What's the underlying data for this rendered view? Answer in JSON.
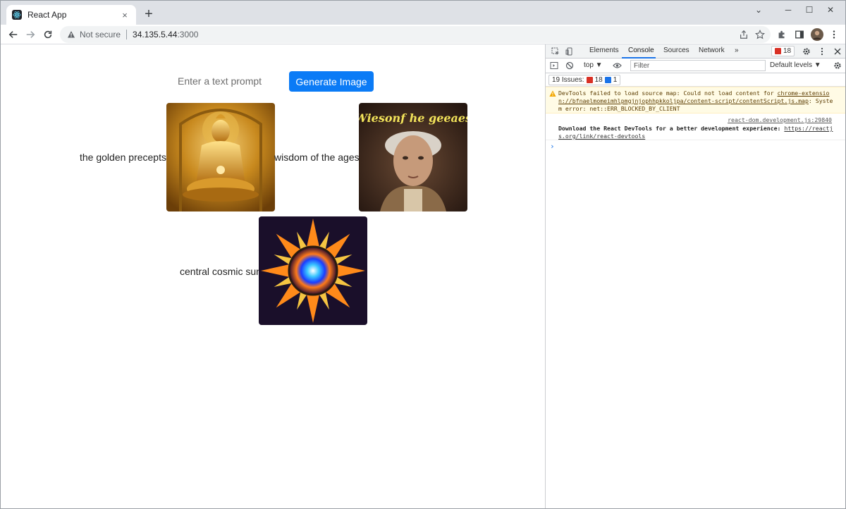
{
  "browser": {
    "tab_title": "React App",
    "tab_close": "×",
    "new_tab": "+",
    "window_controls": {
      "dropdown": "⌄",
      "minimize": "─",
      "maximize": "☐",
      "close": "✕"
    },
    "security_text": "Not secure",
    "url_host": "34.135.5.44",
    "url_port": ":3000",
    "toolbar_icons": [
      "share-icon",
      "star-icon",
      "extensions-icon",
      "sidepanel-icon",
      "profile-avatar",
      "menu-icon"
    ]
  },
  "app": {
    "prompt_placeholder": "Enter a text prompt",
    "generate_label": "Generate Image",
    "results": [
      {
        "caption": "the golden precepts",
        "image": "golden-buddha-statue"
      },
      {
        "caption": "wisdom of the ages",
        "image": "old-man-portrait",
        "image_text": "Wiesonf he geeaes"
      },
      {
        "caption": "central cosmic sun",
        "image": "cosmic-mandala"
      }
    ]
  },
  "devtools": {
    "tabs": [
      "Elements",
      "Console",
      "Sources",
      "Network",
      "»"
    ],
    "active_tab": "Console",
    "error_count": "18",
    "context": "top ▼",
    "filter_placeholder": "Filter",
    "levels": "Default levels ▼",
    "issues_label": "19 Issues:",
    "issues_errors": "18",
    "issues_info": "1",
    "warning": {
      "prefix": "DevTools failed to load source map: Could not load content for ",
      "link": "chrome-extension://bfnaelmomeimhlpmgjnjophhpkkoljpa/content-script/contentScript.js.map",
      "suffix": ": System error: net::ERR_BLOCKED_BY_CLIENT"
    },
    "log": {
      "source": "react-dom.development.js:29840",
      "message": "Download the React DevTools for a better development experience: ",
      "link": "https://reactjs.org/link/react-devtools"
    },
    "prompt_symbol": "›"
  }
}
